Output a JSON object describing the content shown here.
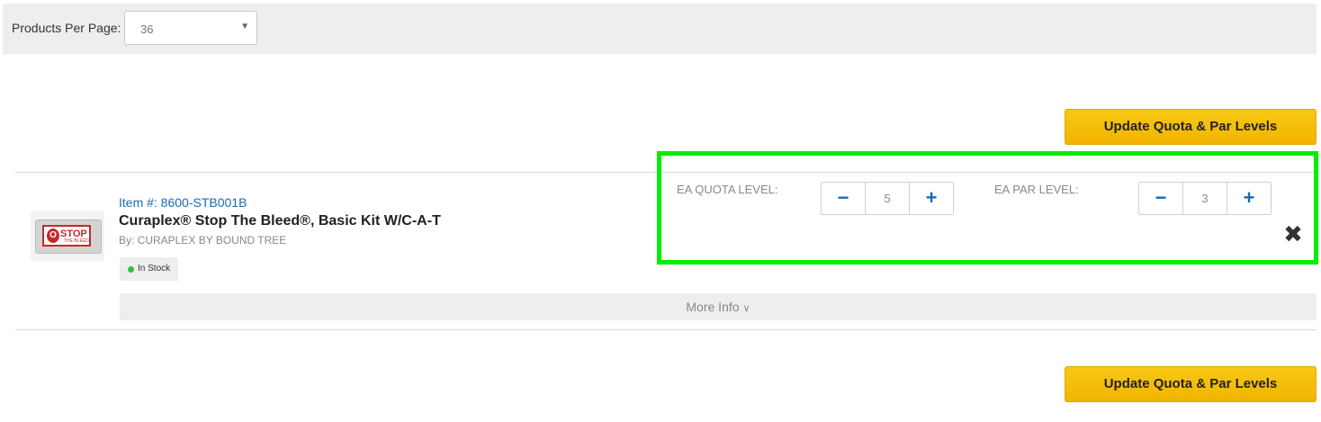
{
  "toolbar": {
    "products_per_page_label": "Products Per Page:",
    "products_per_page_value": "36"
  },
  "update_button_label": "Update Quota & Par Levels",
  "product": {
    "item_number": "Item #: 8600-STB001B",
    "title": "Curaplex® Stop The Bleed®, Basic Kit W/C-A-T",
    "by": "By: CURAPLEX BY BOUND TREE",
    "stock_status": "In Stock",
    "more_info_label": "More Info",
    "image_text": {
      "letter": "O",
      "word": "STOP",
      "sub": "THE BLEED"
    }
  },
  "levels": {
    "quota_label": "EA QUOTA LEVEL:",
    "quota_value": "5",
    "par_label": "EA PAR LEVEL:",
    "par_value": "3"
  },
  "colors": {
    "accent_button": "#f1b400",
    "link": "#1a6bb3",
    "highlight_box": "#00ee00",
    "in_stock_dot": "#2ec23a"
  },
  "icons": {
    "select_arrow": "chevron-down-icon",
    "more_info": "chevron-down-icon",
    "remove": "close-icon"
  }
}
